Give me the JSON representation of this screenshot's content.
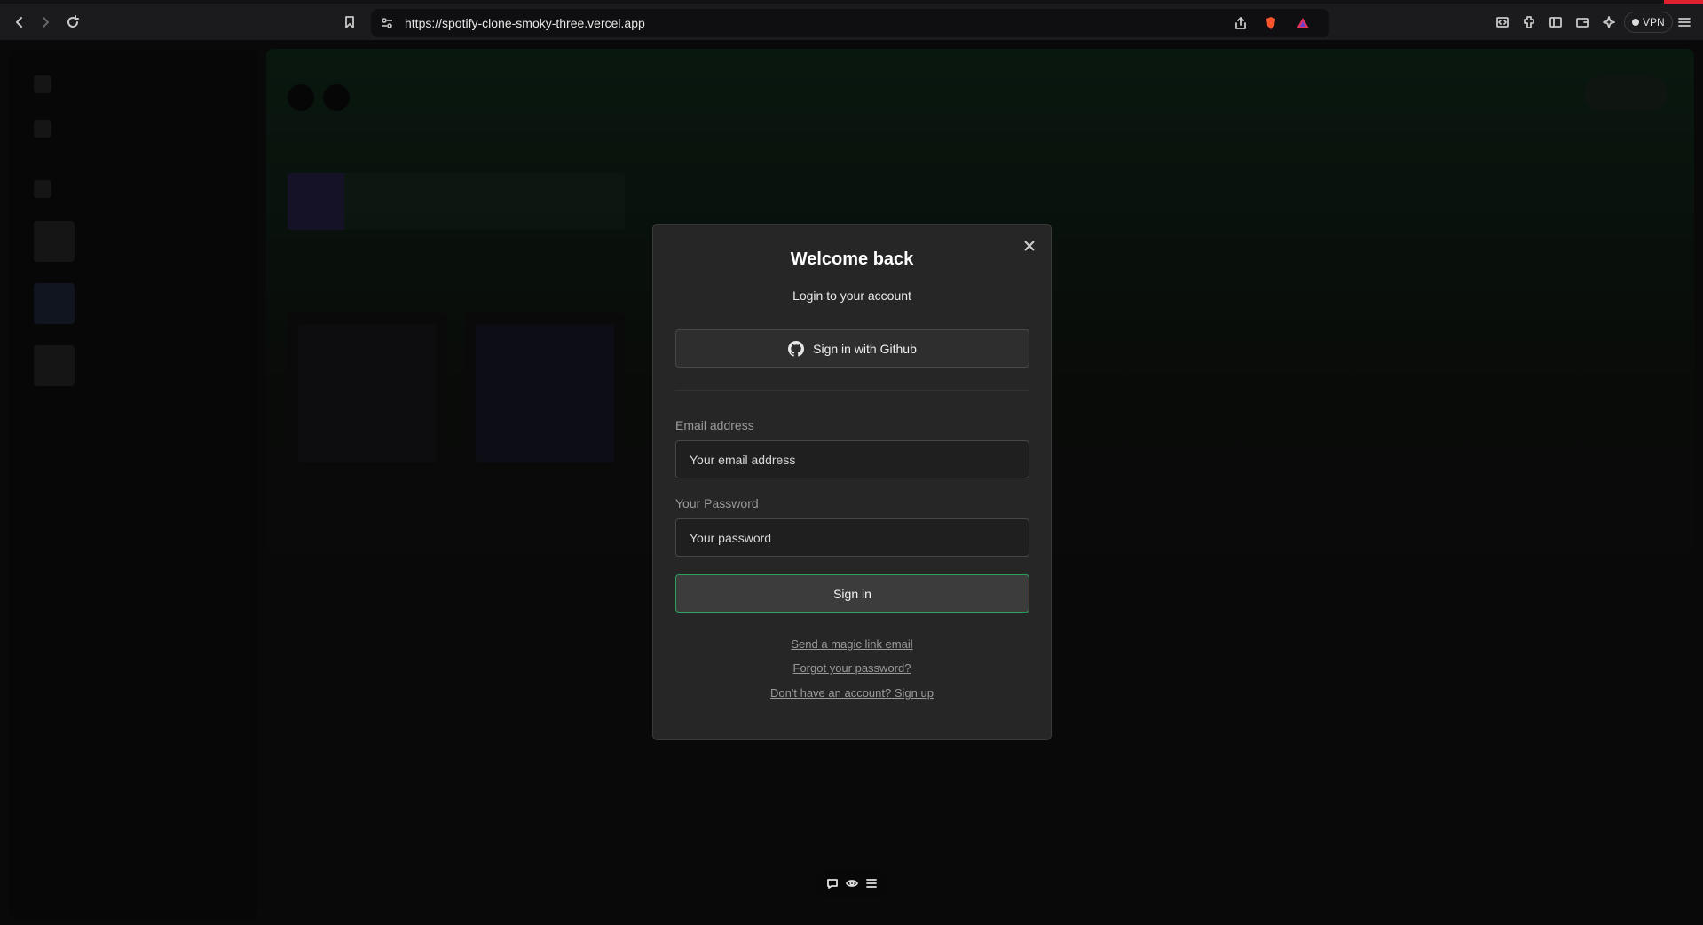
{
  "browser": {
    "url": "https://spotify-clone-smoky-three.vercel.app",
    "vpn_label": "VPN"
  },
  "modal": {
    "title": "Welcome back",
    "subtitle": "Login to your account",
    "github_button": "Sign in with Github",
    "email_label": "Email address",
    "email_placeholder": "Your email address",
    "password_label": "Your Password",
    "password_placeholder": "Your password",
    "signin_button": "Sign in",
    "magic_link": "Send a magic link email",
    "forgot_password": "Forgot your password?",
    "signup_link": "Don't have an account? Sign up"
  },
  "colors": {
    "accent": "#2fa05c",
    "modal_bg": "#262626"
  }
}
